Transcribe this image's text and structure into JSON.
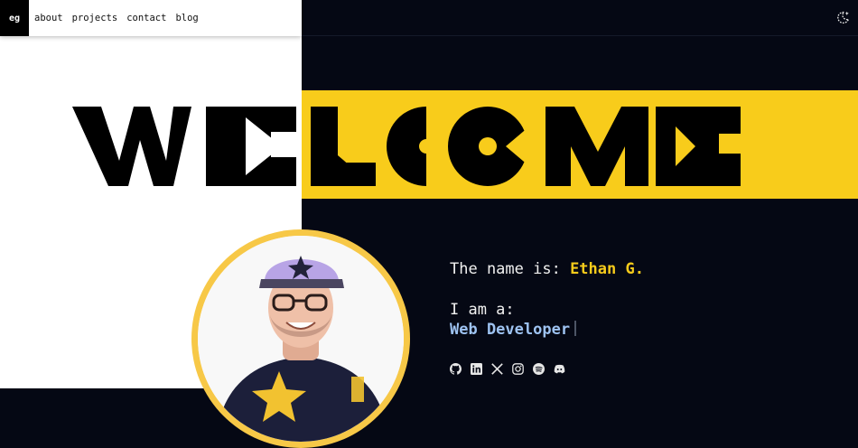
{
  "nav": {
    "logo": "eg",
    "links": [
      "about",
      "projects",
      "contact",
      "blog"
    ]
  },
  "hero": {
    "headline": "WELCOME"
  },
  "intro": {
    "name_prefix": "The name is: ",
    "name": "Ethan G.",
    "role_prefix": "I am a:",
    "role": "Web Developer"
  },
  "socials": [
    "github-icon",
    "linkedin-icon",
    "x-icon",
    "instagram-icon",
    "spotify-icon",
    "discord-icon"
  ],
  "colors": {
    "background": "#050814",
    "accent": "#f8cc1b",
    "role_text": "#9ec3f2",
    "panel": "#ffffff",
    "ring": "#f7c847"
  }
}
